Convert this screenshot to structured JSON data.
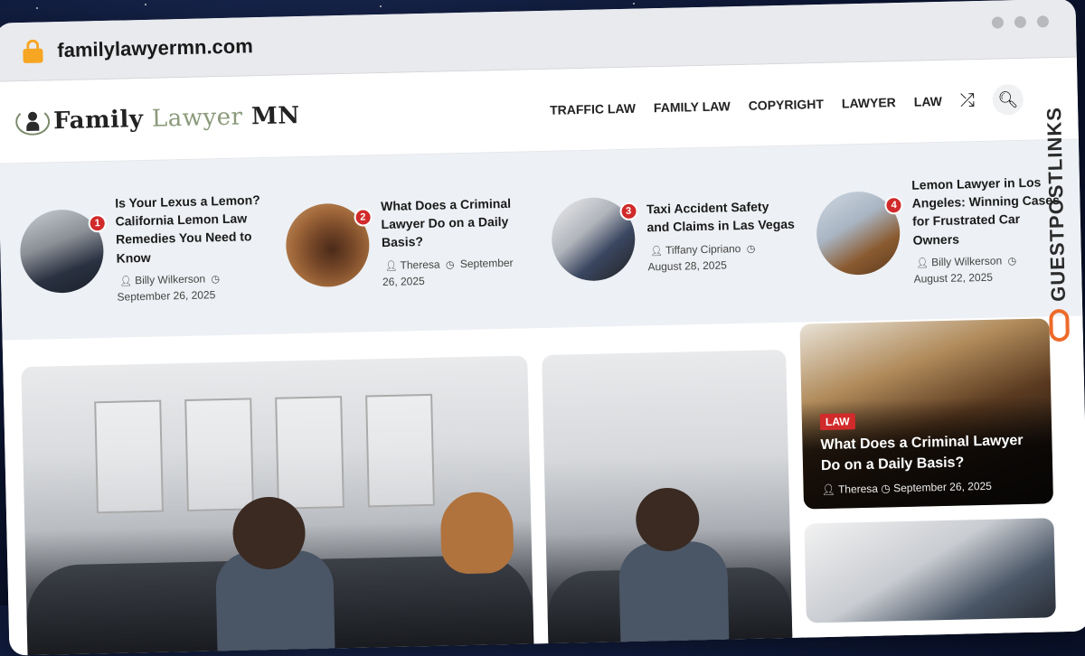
{
  "browser": {
    "url": "familylawyermn.com"
  },
  "logo": {
    "word1": "Family",
    "word2": "Lawyer",
    "word3": "MN"
  },
  "nav": {
    "items": [
      {
        "label": "TRAFFIC LAW"
      },
      {
        "label": "FAMILY LAW"
      },
      {
        "label": "COPYRIGHT"
      },
      {
        "label": "LAWYER"
      },
      {
        "label": "LAW"
      }
    ]
  },
  "trending": [
    {
      "num": "1",
      "title": "Is Your Lexus a Lemon? California Lemon Law Remedies You Need to Know",
      "author": "Billy Wilkerson",
      "date": "September 26, 2025"
    },
    {
      "num": "2",
      "title": "What Does a Criminal Lawyer Do on a Daily Basis?",
      "author": "Theresa",
      "date": "September 26, 2025"
    },
    {
      "num": "3",
      "title": "Taxi Accident Safety and Claims in Las Vegas",
      "author": "Tiffany Cipriano",
      "date": "August 28, 2025"
    },
    {
      "num": "4",
      "title": "Lemon Lawyer in Los Angeles: Winning Cases for Frustrated Car Owners",
      "author": "Billy Wilkerson",
      "date": "August 22, 2025"
    }
  ],
  "side_card": {
    "tag": "LAW",
    "title": "What Does a Criminal Lawyer Do on a Daily Basis?",
    "author": "Theresa",
    "date": "September 26, 2025"
  },
  "watermark": {
    "text": "GUESTPOSTLINKS"
  },
  "colors": {
    "accent": "#d12a2a",
    "lock": "#f6a623",
    "watermark_link": "#ee6a2a"
  },
  "icons": {
    "user": "user-icon",
    "clock": "clock-icon",
    "shuffle": "shuffle-icon",
    "search": "search-icon",
    "lock": "lock-icon"
  }
}
